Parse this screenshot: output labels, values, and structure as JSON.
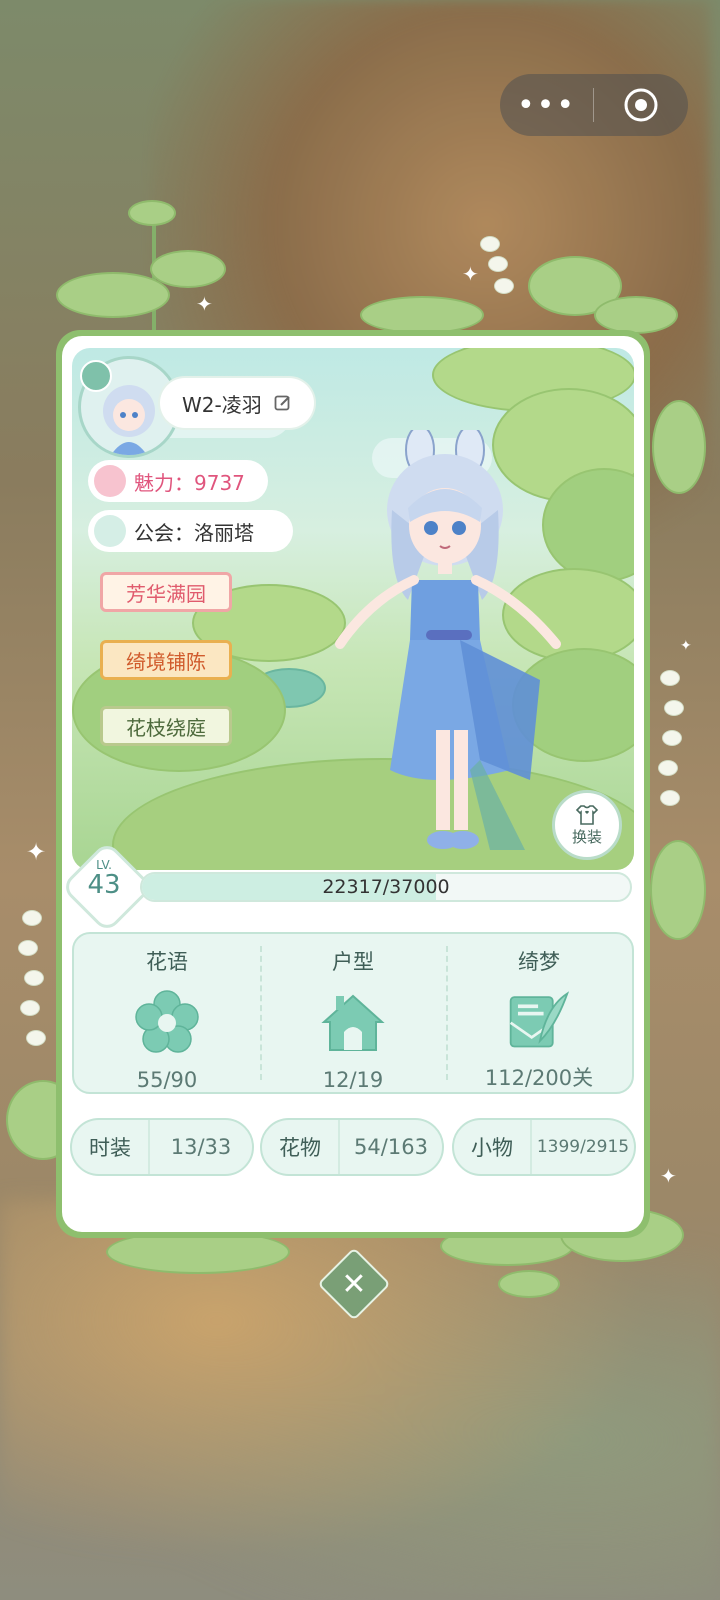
{
  "capsule": {
    "more_glyph": "•••"
  },
  "profile": {
    "name": "W2-凌羽",
    "charm_text": "魅力：9737",
    "guild_text": "公会：洛丽塔"
  },
  "banners": [
    "芳华满园",
    "绮境铺陈",
    "花枝绕庭"
  ],
  "change_outfit_label": "换装",
  "level": {
    "label": "LV.",
    "value": "43",
    "xp_text": "22317/37000",
    "progress": 0.603
  },
  "collection": [
    {
      "title": "花语",
      "value": "55/90",
      "icon": "flower-icon"
    },
    {
      "title": "户型",
      "value": "12/19",
      "icon": "house-icon"
    },
    {
      "title": "绮梦",
      "value": "112/200关",
      "icon": "letter-feather-icon"
    }
  ],
  "chips": [
    {
      "label": "时装",
      "value": "13/33"
    },
    {
      "label": "花物",
      "value": "54/163"
    },
    {
      "label": "小物",
      "value": "1399/2915"
    }
  ],
  "close_glyph": "✕",
  "colors": {
    "accent_green": "#8ebf6e",
    "panel_mint": "#e8f6f1",
    "charm_pink": "#e0557d"
  }
}
